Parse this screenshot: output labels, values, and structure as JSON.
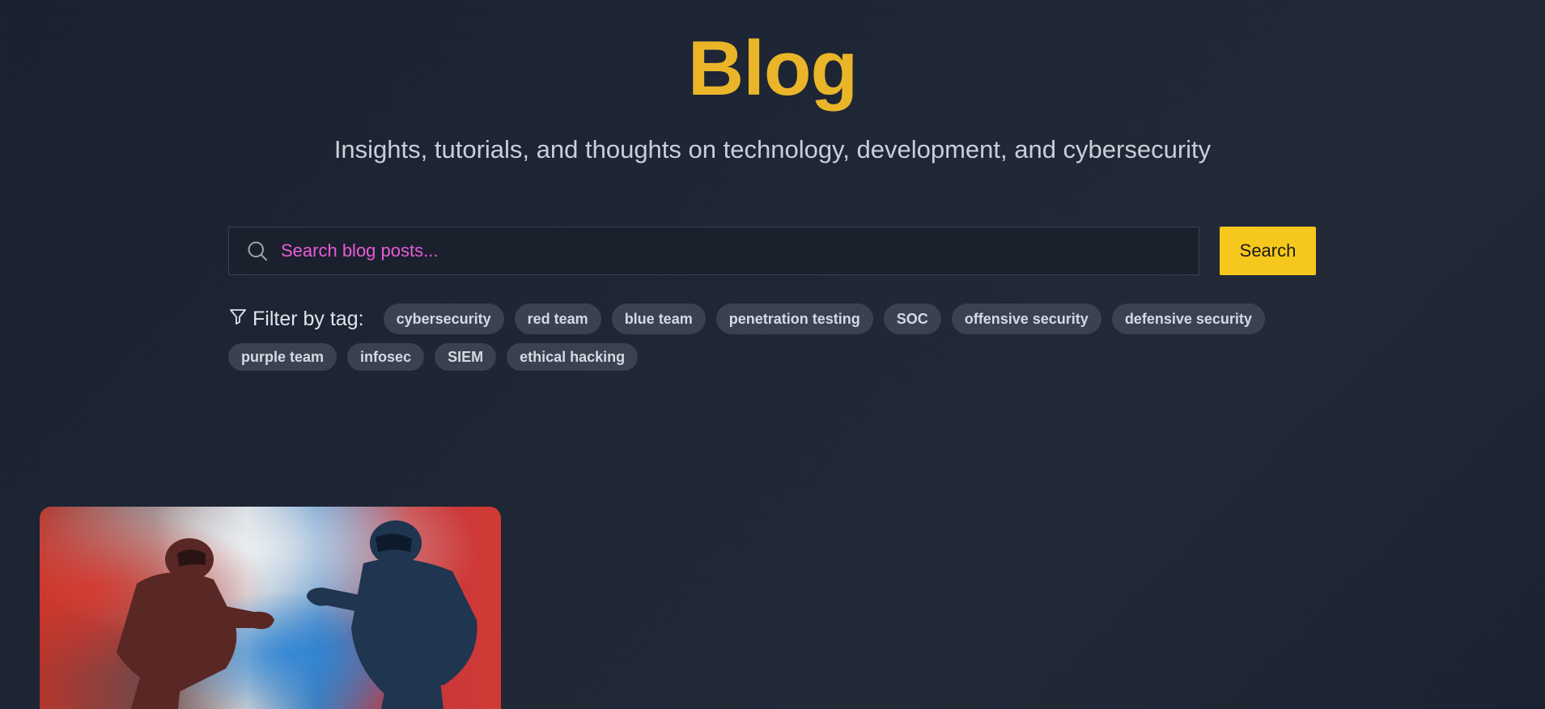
{
  "header": {
    "title": "Blog",
    "subtitle": "Insights, tutorials, and thoughts on technology, development, and cybersecurity"
  },
  "search": {
    "placeholder": "Search blog posts...",
    "value": "",
    "button_label": "Search",
    "icon": "search-icon"
  },
  "filter": {
    "label": "Filter by tag:",
    "icon": "filter-icon",
    "tags_row1": [
      "cybersecurity",
      "red team",
      "blue team",
      "penetration testing",
      "SOC",
      "offensive security",
      "defensive security"
    ],
    "tags_row2": [
      "purple team",
      "infosec",
      "SIEM",
      "ethical hacking"
    ]
  },
  "posts": [
    {
      "image": "red-vs-blue-armored-soldiers-image"
    }
  ],
  "colors": {
    "background": "#1e2534",
    "title": "#eab529",
    "button": "#f6c81d",
    "tag_bg": "#3a4252",
    "placeholder": "#e85bd9"
  }
}
